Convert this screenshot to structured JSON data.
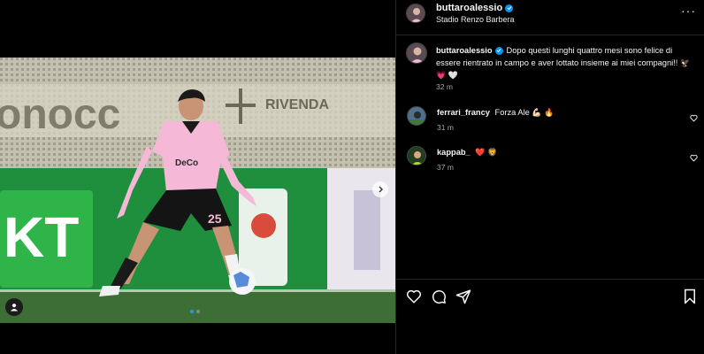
{
  "post": {
    "username": "buttaroalessio",
    "location": "Stadio Renzo Barbera",
    "caption": "Dopo questi lunghi quattro mesi sono felice di essere rientrato in campo e aver lottato insieme ai miei compagni!!",
    "caption_emojis": "🦅 💗 🤍",
    "time": "32 m"
  },
  "comments": [
    {
      "username": "ferrari_francy",
      "text": "Forza Ale",
      "emojis": "💪🏻 🔥",
      "time": "31 m"
    },
    {
      "username": "kappab_",
      "text": "",
      "emojis": "❤️ 🦁",
      "time": "37 m"
    }
  ],
  "photo": {
    "banner_text": "RIVENDA",
    "ad_text": "KT",
    "jersey_number": "25",
    "sponsor": "DeCo",
    "slide_current": 1,
    "slide_count": 2
  },
  "icons": {
    "more": "more-options-icon",
    "like": "heart-icon",
    "comment": "comment-icon",
    "share": "share-icon",
    "save": "bookmark-icon",
    "verified": "verified-badge-icon",
    "tag": "person-tag-icon",
    "next": "chevron-right-icon"
  },
  "colors": {
    "verified": "#0095f6",
    "jersey": "#f5b8d6",
    "pitch": "#3c6e35"
  }
}
